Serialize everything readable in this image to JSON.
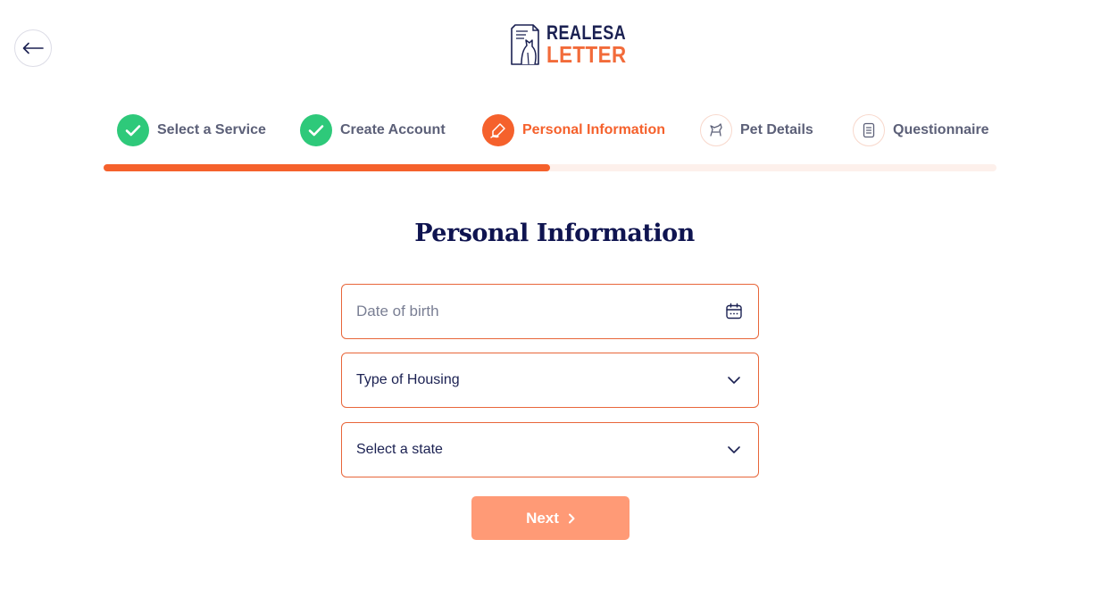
{
  "header": {
    "back_icon": "arrow-left-icon",
    "logo": {
      "line1": "REALESA",
      "line2": "LETTER"
    }
  },
  "steps": [
    {
      "label": "Select a Service",
      "status": "done",
      "icon": "check-icon"
    },
    {
      "label": "Create Account",
      "status": "done",
      "icon": "check-icon"
    },
    {
      "label": "Personal Information",
      "status": "active",
      "icon": "hand-pen-icon"
    },
    {
      "label": "Pet Details",
      "status": "pending",
      "icon": "pet-icon"
    },
    {
      "label": "Questionnaire",
      "status": "pending",
      "icon": "document-icon"
    }
  ],
  "progress": {
    "percent": 50
  },
  "form": {
    "title": "Personal Information",
    "dob": {
      "placeholder": "Date of birth",
      "value": "",
      "icon": "calendar-icon"
    },
    "housing": {
      "value": "Type of Housing",
      "icon": "chevron-down-icon"
    },
    "state": {
      "value": "Select a state",
      "icon": "chevron-down-icon"
    },
    "next_label": "Next"
  },
  "colors": {
    "accent": "#f5612c",
    "done": "#2ec97a",
    "navy": "#0f1450",
    "button": "#ff9a76"
  }
}
